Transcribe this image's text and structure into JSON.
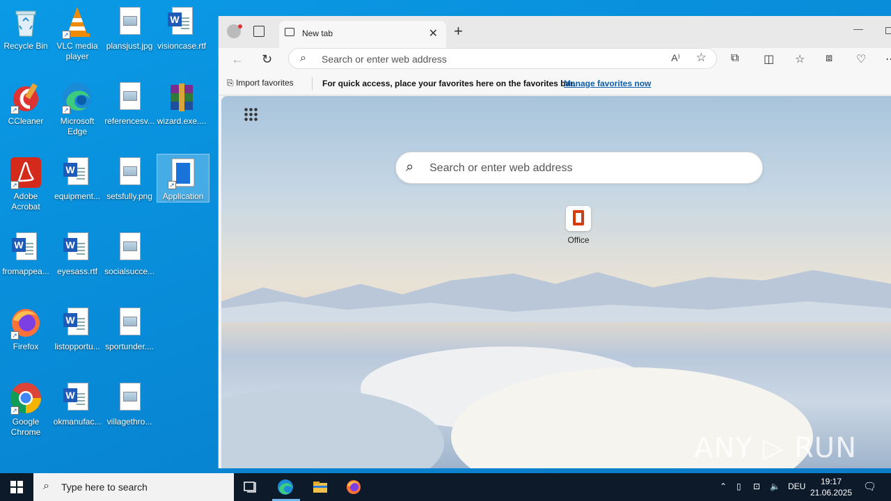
{
  "desktop": {
    "icons": [
      {
        "label": "Recycle Bin"
      },
      {
        "label": "VLC media player"
      },
      {
        "label": "plansjust.jpg"
      },
      {
        "label": "visioncase.rtf"
      },
      {
        "label": "CCleaner"
      },
      {
        "label": "Microsoft Edge"
      },
      {
        "label": "referencesv..."
      },
      {
        "label": "wizard.exe...."
      },
      {
        "label": "Adobe Acrobat"
      },
      {
        "label": "equipment..."
      },
      {
        "label": "setsfully.png"
      },
      {
        "label": "Application"
      },
      {
        "label": "fromappea..."
      },
      {
        "label": "eyesass.rtf"
      },
      {
        "label": "socialsucce..."
      },
      {
        "label": "Firefox"
      },
      {
        "label": "listopportu..."
      },
      {
        "label": "sportunder...."
      },
      {
        "label": "Google Chrome"
      },
      {
        "label": "okmanufac..."
      },
      {
        "label": "villagethro..."
      }
    ]
  },
  "browser": {
    "tab_title": "New tab",
    "address_placeholder": "Search or enter web address",
    "favbar": {
      "import_label": "Import favorites",
      "hint": "For quick access, place your favorites here on the favorites bar.",
      "manage_link": "Manage favorites now"
    },
    "ntp": {
      "search_placeholder": "Search or enter web address",
      "quick_links": [
        {
          "label": "Office"
        }
      ]
    },
    "watermark": "ANY ▷ RUN"
  },
  "taskbar": {
    "search_placeholder": "Type here to search",
    "language": "DEU",
    "time": "19:17",
    "date": "21.06.2025"
  }
}
